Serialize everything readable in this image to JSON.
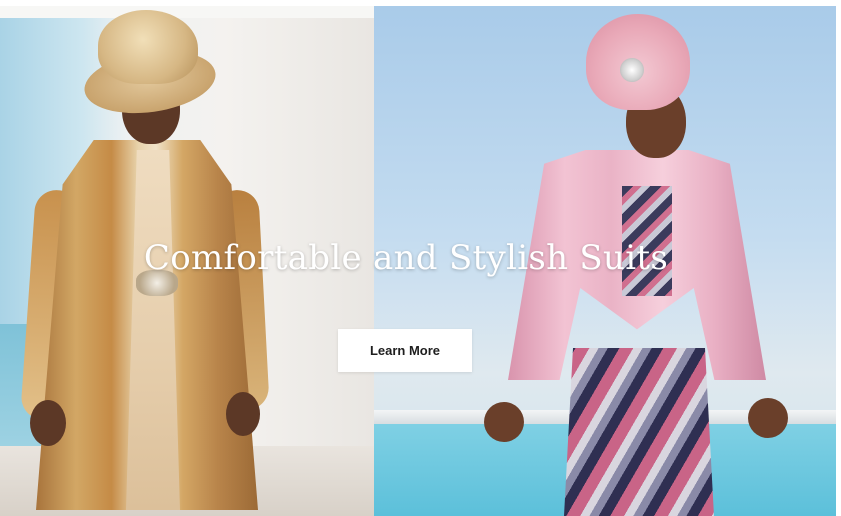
{
  "hero": {
    "headline": "Comfortable and Stylish Suits",
    "cta_label": "Learn More"
  },
  "images": {
    "left": "model in gold brocade long coat and hat",
    "right": "model in pink jacket with printed skirt and hat"
  },
  "colors": {
    "headline_text": "#ffffff",
    "cta_background": "#ffffff",
    "cta_text": "#1e1e1e"
  }
}
